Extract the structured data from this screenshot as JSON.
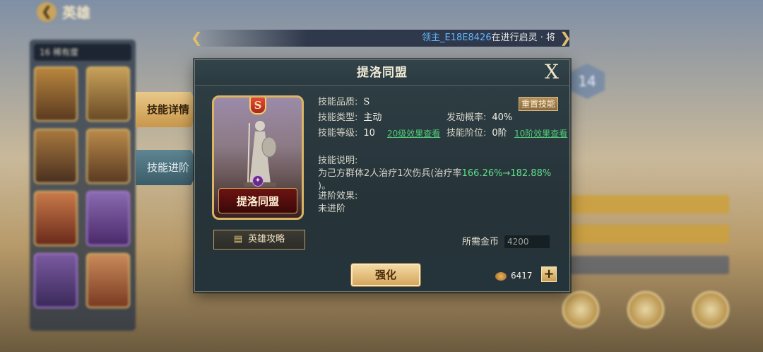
{
  "top": {
    "title": "英雄"
  },
  "notice": {
    "player": "领主_E18E8426",
    "text": "在进行启灵 · 将"
  },
  "sidebar": {
    "filter_label": "16 稀有度"
  },
  "right_panel": {
    "level": "14"
  },
  "tabs": [
    {
      "label": "技能详情",
      "active": true
    },
    {
      "label": "技能进阶",
      "active": false
    }
  ],
  "dialog": {
    "title": "提洛同盟",
    "close_label": "X",
    "card": {
      "grade": "S",
      "name": "提洛同盟"
    },
    "guide_button": "英雄攻略",
    "quality_label": "技能品质:",
    "quality_value": "S",
    "reset_button": "重置技能",
    "type_label": "技能类型:",
    "type_value": "主动",
    "rate_label": "发动概率:",
    "rate_value": "40%",
    "level_label": "技能等级:",
    "level_value": "10",
    "level_link": "20级效果查看",
    "stage_label": "技能阶位:",
    "stage_value": "0阶",
    "stage_link": "10阶效果查看",
    "desc_title": "技能说明:",
    "desc_text_1": "为己方群体2人治疗1次伤兵(治疗率",
    "desc_green": "166.26%→182.88%",
    "desc_text_2": ")。",
    "adv_title": "进阶效果:",
    "adv_value": "未进阶",
    "gold_label": "所需金币",
    "gold_value": "4200",
    "upgrade_button": "强化",
    "coin_count": "6417",
    "plus_label": "+"
  },
  "colors": {
    "accent_gold": "#d9b564",
    "green_text": "#5fe08a",
    "link_green": "#4fca78",
    "player_blue": "#5fb7ff"
  }
}
